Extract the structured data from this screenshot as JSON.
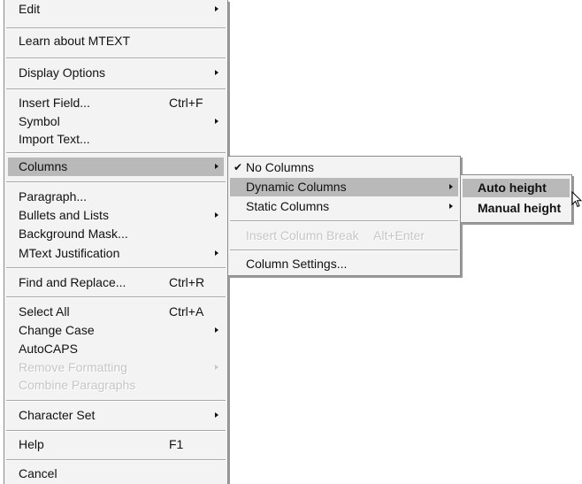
{
  "main_menu": {
    "edit": "Edit",
    "learn": "Learn about MTEXT",
    "display_options": "Display Options",
    "insert_field": "Insert Field...",
    "insert_field_shortcut": "Ctrl+F",
    "symbol": "Symbol",
    "import_text": "Import Text...",
    "columns": "Columns",
    "paragraph": "Paragraph...",
    "bullets": "Bullets and Lists",
    "background_mask": "Background Mask...",
    "justification": "MText Justification",
    "find_replace": "Find and Replace...",
    "find_replace_shortcut": "Ctrl+R",
    "select_all": "Select All",
    "select_all_shortcut": "Ctrl+A",
    "change_case": "Change Case",
    "autocaps": "AutoCAPS",
    "remove_formatting": "Remove Formatting",
    "combine_paragraphs": "Combine Paragraphs",
    "character_set": "Character Set",
    "help": "Help",
    "help_shortcut": "F1",
    "cancel": "Cancel"
  },
  "columns_menu": {
    "check_mark": "✔",
    "no_columns": "No Columns",
    "dynamic_columns": "Dynamic Columns",
    "static_columns": "Static Columns",
    "insert_column_break": "Insert Column Break",
    "insert_column_break_shortcut": "Alt+Enter",
    "column_settings": "Column Settings..."
  },
  "dynamic_menu": {
    "auto_height": "Auto height",
    "manual_height": "Manual height"
  },
  "colors": {
    "menu_bg": "#f3f3f3",
    "highlight": "#b9b9b9",
    "disabled_text": "#c6c6c6"
  }
}
